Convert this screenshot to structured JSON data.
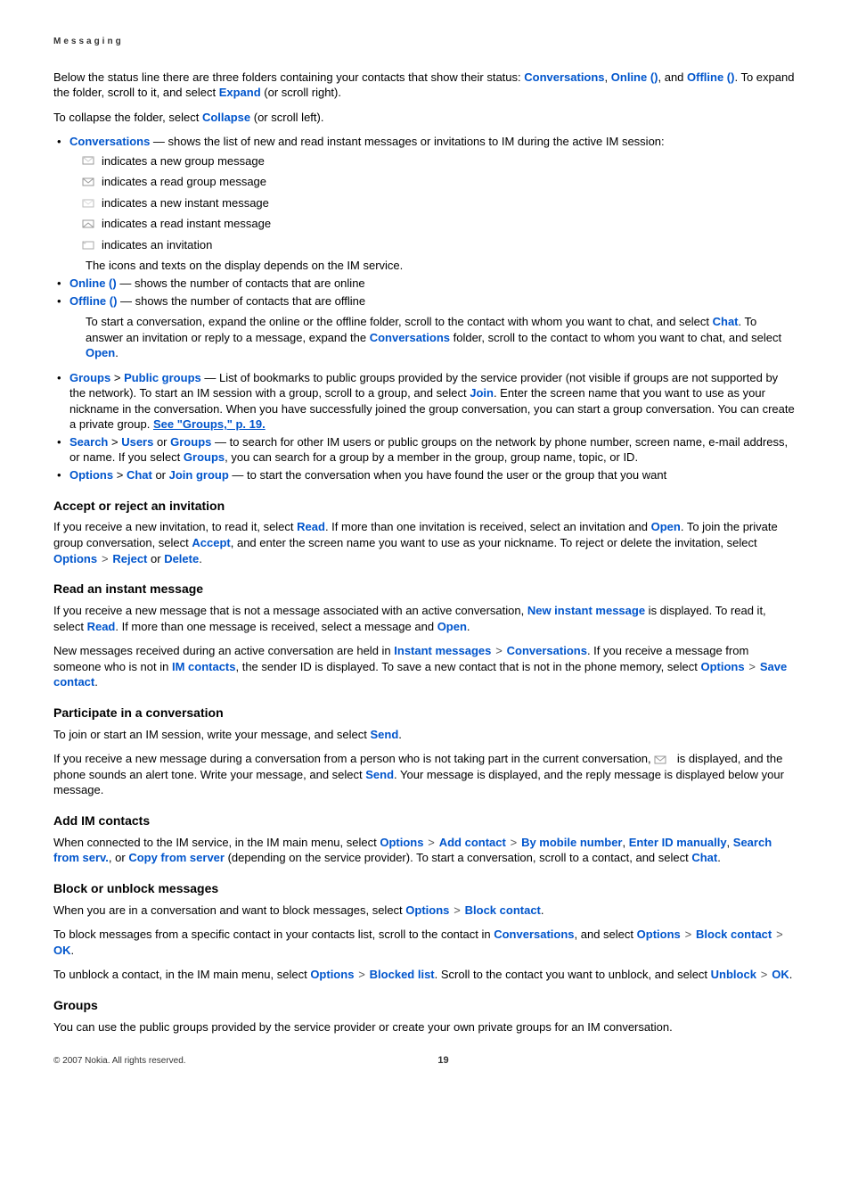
{
  "header": "Messaging",
  "intro1_a": "Below the status line there are three folders containing your contacts that show their status: ",
  "intro1_conv": "Conversations",
  "comma": ", ",
  "intro1_online": "Online ()",
  "intro1_and": ", and ",
  "intro1_offline": "Offline ()",
  "intro1_b": ". To expand the folder, scroll to it, and select ",
  "intro1_expand": "Expand",
  "intro1_c": " (or scroll right).",
  "collapse_a": "To collapse the folder, select ",
  "collapse_link": "Collapse",
  "collapse_b": " (or scroll left).",
  "conv_label": "Conversations",
  "conv_desc": " — shows the list of new and read instant messages or invitations to IM during the active IM session:",
  "sub1": " indicates a new group message",
  "sub2": " indicates a read group message",
  "sub3": " indicates a new instant message",
  "sub4": " indicates a read instant message",
  "sub5": " indicates an invitation",
  "icons_note": "The icons and texts on the display depends on the IM service.",
  "online_label": "Online ()",
  "online_desc": " — shows the number of contacts that are online",
  "offline_label": "Offline ()",
  "offline_desc": " — shows the number of contacts that are offline",
  "start_conv_a": "To start a conversation, expand the online or the offline folder, scroll to the contact with whom you want to chat, and select ",
  "chat": "Chat",
  "start_conv_b": ". To answer an invitation or reply to a message, expand the ",
  "start_conv_c": " folder, scroll to the contact to whom you want to chat, and select ",
  "open": "Open",
  "period": ".",
  "groups_label": "Groups",
  "gt": " > ",
  "public_groups": "Public groups",
  "groups_desc_a": " — List of bookmarks to public groups provided by the service provider (not visible if groups are not supported by the network). To start an IM session with a group, scroll to a group, and select ",
  "join": "Join",
  "groups_desc_b": ". Enter the screen name that you want to use as your nickname in the conversation. When you have successfully joined the group conversation, you can start a group conversation. You can create a private group. ",
  "see_groups": "See \"Groups,\" p. 19.",
  "search_label": "Search",
  "users": "Users",
  "or": " or ",
  "groups2": "Groups",
  "search_desc_a": "  — to search for other IM users or public groups on the network by phone number, screen name, e-mail address, or name. If you select ",
  "search_desc_b": ", you can search for a group by a member in the group, group name, topic, or ID.",
  "options": "Options",
  "join_group": "Join group",
  "options_desc": " — to start the conversation when you have found the user or the group that you want",
  "h_accept": "Accept or reject an invitation",
  "accept_a": "If you receive a new invitation, to read it, select ",
  "read": "Read",
  "accept_b": ". If more than one invitation is received, select an invitation and ",
  "accept_c": ". To join the private group conversation, select ",
  "accept": "Accept",
  "accept_d": ", and enter the screen name you want to use as your nickname. To reject or delete the invitation, select ",
  "reject": "Reject",
  "delete": "Delete",
  "h_read": "Read an instant message",
  "read_a": "If you receive a new message that is not a message associated with an active conversation, ",
  "new_instant": "New instant message",
  "read_b": " is displayed. To read it, select ",
  "read_c": ". If more than one message is received, select a message and ",
  "read2_a": "New messages received during an active conversation are held in ",
  "instant_messages": "Instant messages",
  "read2_b": ". If you receive a message from someone who is not in ",
  "im_contacts": "IM contacts",
  "read2_c": ", the sender ID is displayed. To save a new contact that is not in the phone memory, select ",
  "save_contact": "Save contact",
  "h_participate": "Participate in a conversation",
  "part_a": "To join or start an IM session, write your message, and select ",
  "send": "Send",
  "part_b": "If you receive a new message during a conversation from a person who is not taking part in the current conversation, ",
  "part_c": " is displayed, and the phone sounds an alert tone. Write your message, and select ",
  "part_d": ". Your message is displayed, and the reply message is displayed below your message.",
  "h_add": "Add IM contacts",
  "add_a": "When connected to the IM service, in the IM main menu, select ",
  "add_contact": "Add contact",
  "by_mobile": "By mobile number",
  "enter_id": "Enter ID manually",
  "search_serv": "Search from serv.",
  "copy_server": "Copy from server",
  "add_b": " (depending on the service provider). To start a conversation, scroll to a contact, and select ",
  "h_block": "Block or unblock messages",
  "block_a": "When you are in a conversation and want to block messages, select ",
  "block_contact": "Block contact",
  "block2_a": "To block messages from a specific contact in your contacts list, scroll to the contact in ",
  "block2_b": ", and select ",
  "ok": "OK",
  "unblock_a": "To unblock a contact, in the IM main menu, select ",
  "blocked_list": "Blocked list",
  "unblock_b": ". Scroll to the contact you want to unblock, and select ",
  "unblock": "Unblock",
  "h_groups": "Groups",
  "groups_p": "You can use the public groups provided by the service provider or create your own private groups for an IM conversation.",
  "copyright": "© 2007 Nokia. All rights reserved.",
  "page_num": "19",
  "chev": ">"
}
